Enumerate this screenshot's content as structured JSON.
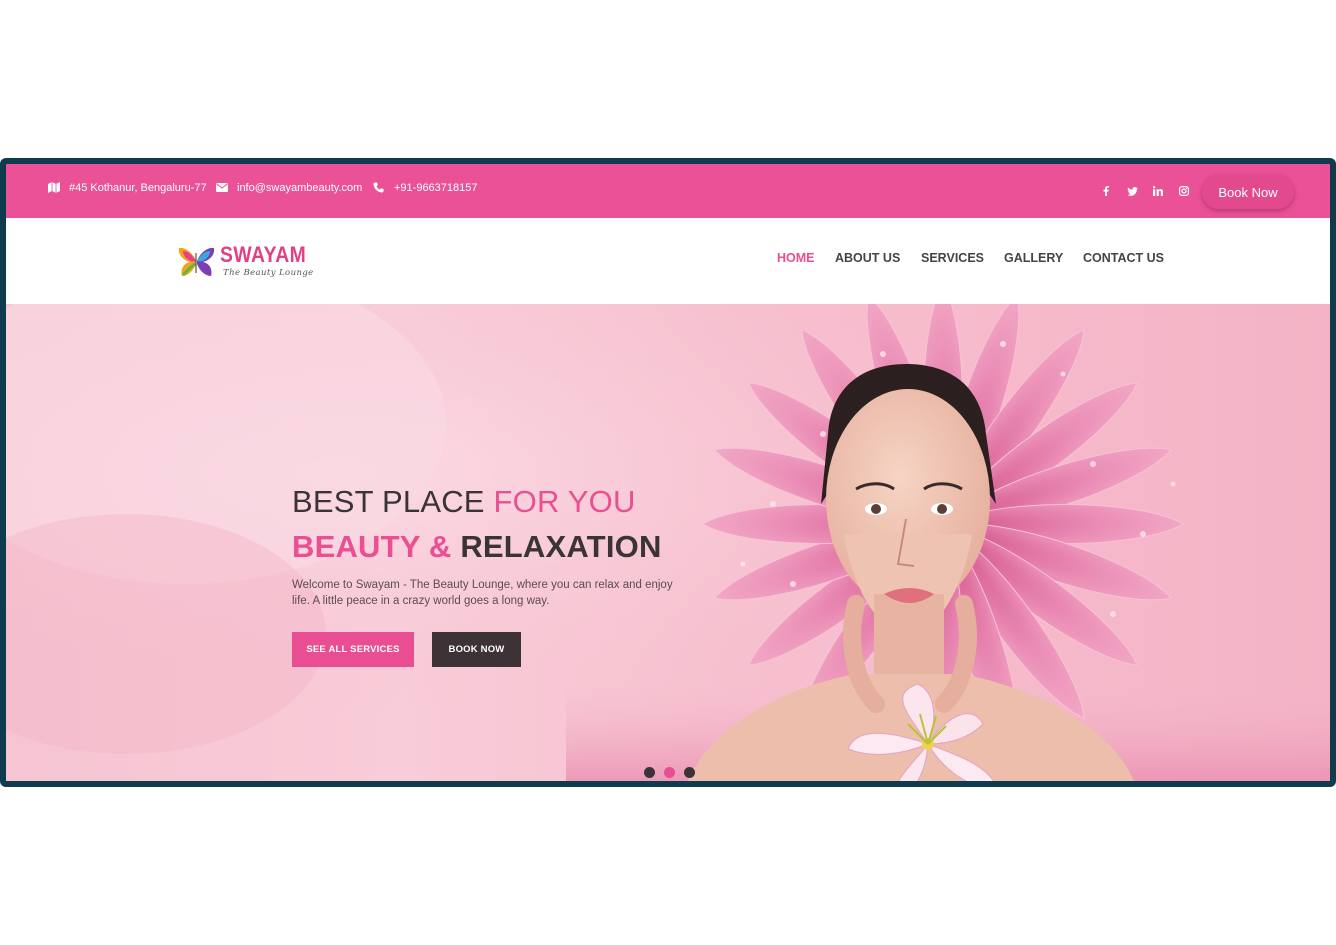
{
  "topbar": {
    "address": "#45 Kothanur, Bengaluru-77",
    "email": "info@swayambeauty.com",
    "phone": "+91-9663718157",
    "social": [
      "facebook-icon",
      "twitter-icon",
      "linkedin-icon",
      "instagram-icon"
    ],
    "book_label": "Book Now"
  },
  "brand": {
    "name": "SWAYAM",
    "tagline": "The Beauty Lounge"
  },
  "nav": {
    "items": [
      {
        "label": "HOME",
        "active": true
      },
      {
        "label": "ABOUT US",
        "active": false
      },
      {
        "label": "SERVICES",
        "active": false
      },
      {
        "label": "GALLERY",
        "active": false
      },
      {
        "label": "CONTACT US",
        "active": false
      }
    ]
  },
  "hero": {
    "title_line1_dark": "BEST PLACE",
    "title_line1_pink": "FOR YOU",
    "title_line2_pink": "BEAUTY &",
    "title_line2_dark": "RELAXATION",
    "description": "Welcome to Swayam - The Beauty Lounge, where you can relax and enjoy life. A little peace in a crazy world goes a long way.",
    "button_services": "SEE ALL SERVICES",
    "button_book": "BOOK NOW",
    "slider": {
      "count": 3,
      "active_index": 1
    }
  },
  "colors": {
    "brand_pink": "#ea5196",
    "dark": "#3a3436",
    "frame": "#0f3c4c"
  }
}
